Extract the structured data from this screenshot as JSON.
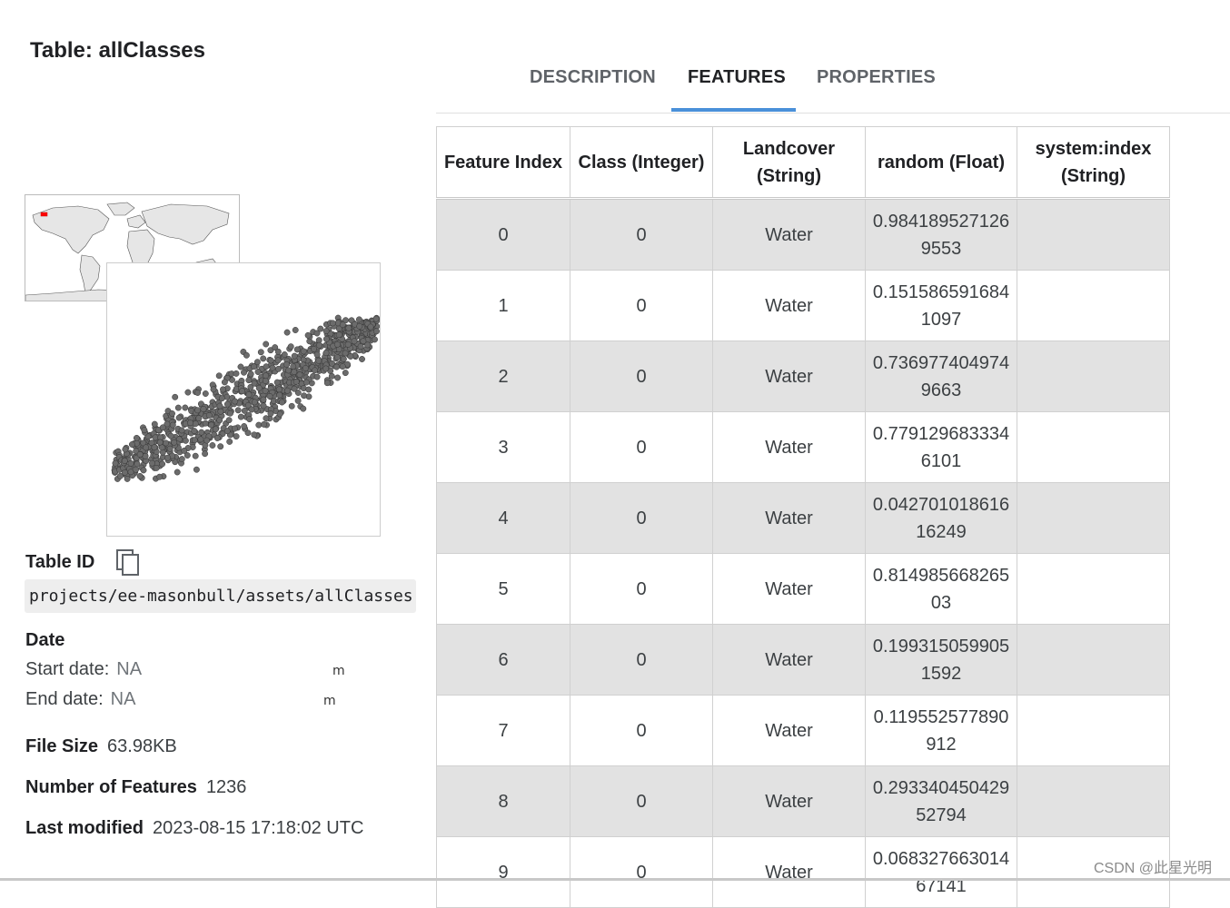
{
  "page": {
    "title": "Table: allClasses"
  },
  "tabs": [
    {
      "label": "DESCRIPTION",
      "active": false
    },
    {
      "label": "FEATURES",
      "active": true
    },
    {
      "label": "PROPERTIES",
      "active": false
    }
  ],
  "details": {
    "table_id_label": "Table ID",
    "table_id": "projects/ee-masonbull/assets/allClasses",
    "date_label": "Date",
    "start_date_label": "Start date:",
    "start_date_value": "NA",
    "end_date_label": "End date:",
    "end_date_value": "NA",
    "start_mark": "m",
    "end_mark": "m",
    "file_size_label": "File Size",
    "file_size_value": "63.98KB",
    "num_features_label": "Number of Features",
    "num_features_value": "1236",
    "last_modified_label": "Last modified",
    "last_modified_value": "2023-08-15 17:18:02 UTC"
  },
  "table": {
    "headers": [
      "Feature Index",
      "Class (Integer)",
      "Landcover (String)",
      "random (Float)",
      "system:index (String)"
    ],
    "rows": [
      [
        "0",
        "0",
        "Water",
        "0.9841895271269553",
        ""
      ],
      [
        "1",
        "0",
        "Water",
        "0.1515865916841097",
        ""
      ],
      [
        "2",
        "0",
        "Water",
        "0.7369774049749663",
        ""
      ],
      [
        "3",
        "0",
        "Water",
        "0.7791296833346101",
        ""
      ],
      [
        "4",
        "0",
        "Water",
        "0.04270101861616249",
        ""
      ],
      [
        "5",
        "0",
        "Water",
        "0.81498566826503",
        ""
      ],
      [
        "6",
        "0",
        "Water",
        "0.1993150599051592",
        ""
      ],
      [
        "7",
        "0",
        "Water",
        "0.119552577890912",
        ""
      ],
      [
        "8",
        "0",
        "Water",
        "0.29334045042952794",
        ""
      ],
      [
        "9",
        "0",
        "Water",
        "0.06832766301467141",
        ""
      ]
    ]
  },
  "watermark": "CSDN @此星光明",
  "colors": {
    "accent": "#4a90d9",
    "row_alt": "#e2e2e2",
    "point": "#6b6b6b"
  }
}
